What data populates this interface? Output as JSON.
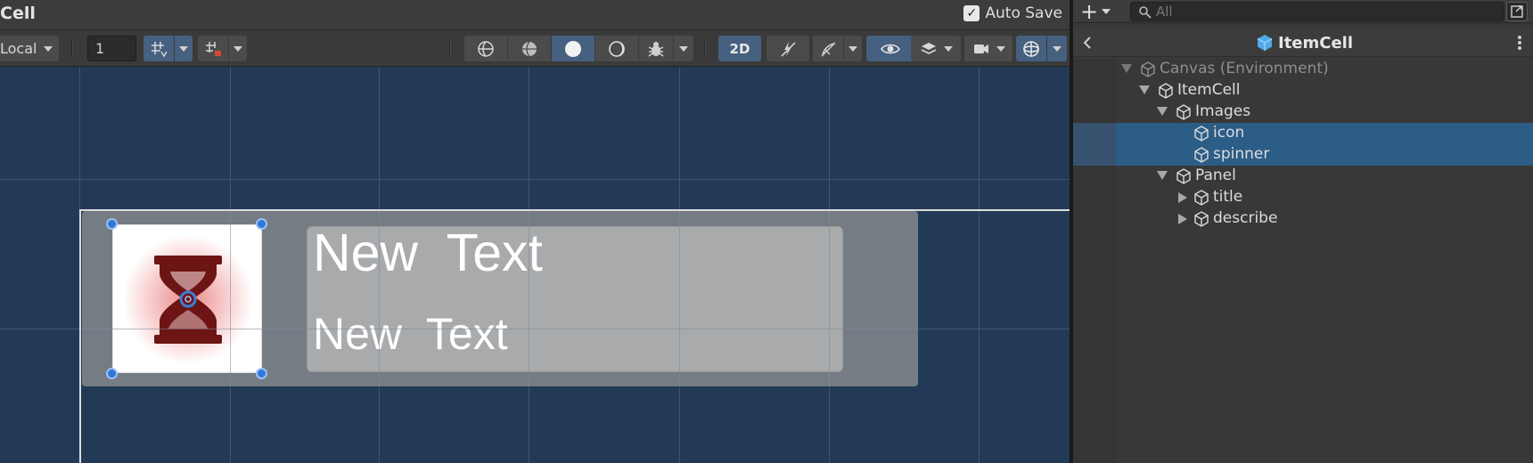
{
  "scene": {
    "title": "Cell",
    "auto_save_label": "Auto Save",
    "auto_save_checked": true,
    "toolbar": {
      "pivot_mode": "Local",
      "grid_snap_value": "1",
      "mode_2d_label": "2D",
      "icons": [
        "grid-snap-icon",
        "snap-increment-icon",
        "wireframe-icon",
        "shaded-wireframe-icon",
        "shaded-icon",
        "unlit-icon",
        "debug-icon",
        "2d-toggle",
        "lighting-icon",
        "effects-icon",
        "visibility-icon",
        "layers-icon",
        "camera-icon",
        "gizmos-icon"
      ]
    },
    "content": {
      "title_text": "New  Text",
      "describe_text": "New  Text",
      "icon": "hourglass-icon"
    }
  },
  "hierarchy": {
    "search_placeholder": "All",
    "prefab_name": "ItemCell",
    "tree": [
      {
        "name": "Canvas (Environment)",
        "depth": 0,
        "expand": "down",
        "selected": false,
        "dim": true
      },
      {
        "name": "ItemCell",
        "depth": 1,
        "expand": "down",
        "selected": false,
        "dim": false
      },
      {
        "name": "Images",
        "depth": 2,
        "expand": "down",
        "selected": false,
        "dim": false
      },
      {
        "name": "icon",
        "depth": 3,
        "expand": "none",
        "selected": true,
        "dim": false
      },
      {
        "name": "spinner",
        "depth": 3,
        "expand": "none",
        "selected": true,
        "dim": false
      },
      {
        "name": "Panel",
        "depth": 2,
        "expand": "down",
        "selected": false,
        "dim": false
      },
      {
        "name": "title",
        "depth": 3,
        "expand": "right",
        "selected": false,
        "dim": false
      },
      {
        "name": "describe",
        "depth": 3,
        "expand": "right",
        "selected": false,
        "dim": false
      }
    ]
  },
  "colors": {
    "scene_background": "#233a56",
    "selection": "#2c5d87",
    "toolbar_active": "#46607f"
  }
}
